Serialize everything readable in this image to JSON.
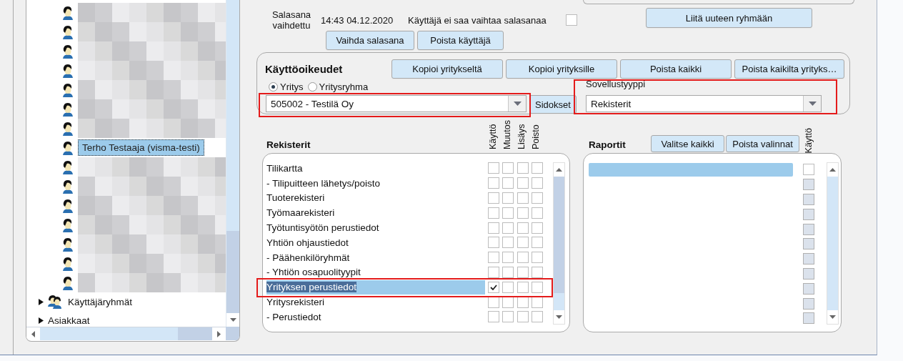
{
  "tree": {
    "items": [
      {
        "kind": "hidden",
        "selected": false
      },
      {
        "kind": "hidden",
        "selected": false
      },
      {
        "kind": "hidden",
        "selected": false
      },
      {
        "kind": "hidden",
        "selected": false
      },
      {
        "kind": "hidden",
        "selected": false
      },
      {
        "kind": "hidden",
        "selected": false
      },
      {
        "kind": "hidden",
        "selected": false
      },
      {
        "kind": "user",
        "label": "Terho Testaaja (visma-testi)",
        "selected": true
      },
      {
        "kind": "hidden",
        "selected": false
      },
      {
        "kind": "hidden",
        "selected": false
      },
      {
        "kind": "hidden",
        "selected": false
      },
      {
        "kind": "hidden",
        "selected": false
      },
      {
        "kind": "hidden",
        "selected": false
      },
      {
        "kind": "hidden",
        "selected": false
      },
      {
        "kind": "hidden",
        "selected": false
      },
      {
        "kind": "group",
        "label": "Käyttäjäryhmät",
        "expanded": false,
        "selected": false
      },
      {
        "kind": "folder",
        "label": "Asiakkaat",
        "expanded": false,
        "selected": false
      }
    ]
  },
  "password": {
    "changed_label": "Salasana vaihdettu",
    "changed_value": "14:43 04.12.2020",
    "no_change": {
      "label": "Käyttäjä ei saa vaihtaa salasanaa",
      "checked": false
    }
  },
  "user_buttons": [
    "Vaihda salasana",
    "Poista käyttäjä"
  ],
  "group_button": "Liitä uuteen ryhmään",
  "rights": {
    "title": "Käyttöoikeudet",
    "buttons": [
      "Kopioi yritykseltä",
      "Kopioi yrityksille",
      "Poista kaikki",
      "Poista kaikilta yrityks…"
    ],
    "scope": [
      {
        "label": "Yritys",
        "selected": true
      },
      {
        "label": "Yritysryhma",
        "selected": false
      }
    ],
    "company": "505002 - Testilä Oy",
    "links_button": "Sidokset",
    "app_type_label": "Sovellustyyppi",
    "app_type": "Rekisterit"
  },
  "registers": {
    "title": "Rekisterit",
    "columns": [
      "Käyttö",
      "Muutos",
      "Lisäys",
      "Poisto"
    ],
    "rows": [
      {
        "label": "Tilikartta",
        "selected": false,
        "rights": [
          false,
          false,
          false,
          false
        ]
      },
      {
        "label": "- Tilipuitteen lähetys/poisto",
        "selected": false,
        "rights": [
          false,
          false,
          false,
          false
        ]
      },
      {
        "label": "Tuoterekisteri",
        "selected": false,
        "rights": [
          false,
          false,
          false,
          false
        ]
      },
      {
        "label": "Työmaarekisteri",
        "selected": false,
        "rights": [
          false,
          false,
          false,
          false
        ]
      },
      {
        "label": "Työtuntisyötön perustiedot",
        "selected": false,
        "rights": [
          false,
          false,
          false,
          false
        ]
      },
      {
        "label": "Yhtiön ohjaustiedot",
        "selected": false,
        "rights": [
          false,
          false,
          false,
          false
        ]
      },
      {
        "label": "- Päähenkilöryhmät",
        "selected": false,
        "rights": [
          false,
          false,
          false,
          false
        ]
      },
      {
        "label": "- Yhtiön osapuolityypit",
        "selected": false,
        "rights": [
          false,
          false,
          false,
          false
        ]
      },
      {
        "label": "Yrityksen perustiedot",
        "selected": true,
        "rights": [
          true,
          false,
          false,
          false
        ]
      },
      {
        "label": "Yritysrekisteri",
        "selected": false,
        "rights": [
          false,
          false,
          false,
          false
        ]
      },
      {
        "label": "- Perustiedot",
        "selected": false,
        "rights": [
          false,
          false,
          false,
          false
        ]
      }
    ]
  },
  "reports": {
    "title": "Raportit",
    "buttons": [
      "Valitse kaikki",
      "Poista valinnat"
    ],
    "column": "Käyttö",
    "rows": [
      {
        "selected": true,
        "checked": false,
        "disabled": false
      },
      {
        "selected": false,
        "checked": false,
        "disabled": true
      },
      {
        "selected": false,
        "checked": false,
        "disabled": true
      },
      {
        "selected": false,
        "checked": false,
        "disabled": true
      },
      {
        "selected": false,
        "checked": false,
        "disabled": true
      },
      {
        "selected": false,
        "checked": false,
        "disabled": true
      },
      {
        "selected": false,
        "checked": false,
        "disabled": true
      },
      {
        "selected": false,
        "checked": false,
        "disabled": true
      },
      {
        "selected": false,
        "checked": false,
        "disabled": true
      },
      {
        "selected": false,
        "checked": false,
        "disabled": true
      },
      {
        "selected": false,
        "checked": false,
        "disabled": true
      }
    ]
  }
}
